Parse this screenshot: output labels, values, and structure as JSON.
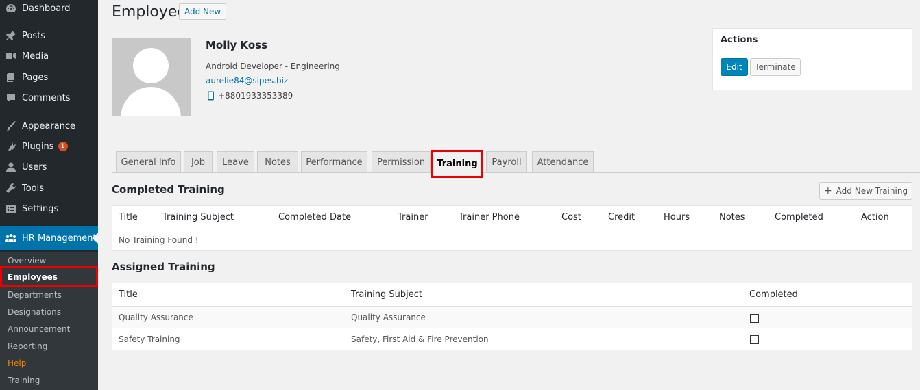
{
  "sidebar": {
    "items": [
      {
        "label": "Dashboard",
        "icon": "dashboard-icon"
      },
      {
        "label": "Posts",
        "icon": "pin-icon"
      },
      {
        "label": "Media",
        "icon": "media-icon"
      },
      {
        "label": "Pages",
        "icon": "pages-icon"
      },
      {
        "label": "Comments",
        "icon": "comment-icon"
      },
      {
        "label": "Appearance",
        "icon": "brush-icon"
      },
      {
        "label": "Plugins",
        "icon": "plugin-icon",
        "badge": "1"
      },
      {
        "label": "Users",
        "icon": "user-icon"
      },
      {
        "label": "Tools",
        "icon": "wrench-icon"
      },
      {
        "label": "Settings",
        "icon": "settings-icon"
      },
      {
        "label": "HR Management",
        "icon": "groups-icon"
      }
    ],
    "submenu": [
      {
        "label": "Overview"
      },
      {
        "label": "Employees"
      },
      {
        "label": "Departments"
      },
      {
        "label": "Designations"
      },
      {
        "label": "Announcement"
      },
      {
        "label": "Reporting"
      },
      {
        "label": "Help"
      },
      {
        "label": "Training"
      }
    ],
    "colors": {
      "bg": "#23282d",
      "submenu_bg": "#32373c",
      "active": "#0073aa",
      "help": "#f18500",
      "badge": "#d54e21"
    }
  },
  "header": {
    "title": "Employee",
    "add_new": "Add New"
  },
  "employee": {
    "name": "Molly Koss",
    "role": "Android Developer - Engineering",
    "email": "aurelie84@sipes.biz",
    "phone": "+8801933353389"
  },
  "actions": {
    "title": "Actions",
    "edit": "Edit",
    "terminate": "Terminate"
  },
  "tabs": [
    {
      "label": "General Info"
    },
    {
      "label": "Job"
    },
    {
      "label": "Leave"
    },
    {
      "label": "Notes"
    },
    {
      "label": "Performance"
    },
    {
      "label": "Permission"
    },
    {
      "label": "Training",
      "active": true
    },
    {
      "label": "Payroll"
    },
    {
      "label": "Attendance"
    }
  ],
  "completed_training": {
    "title": "Completed Training",
    "add_button": "Add New Training",
    "columns": [
      "Title",
      "Training Subject",
      "Completed Date",
      "Trainer",
      "Trainer Phone",
      "Cost",
      "Credit",
      "Hours",
      "Notes",
      "Completed",
      "Action"
    ],
    "empty_message": "No Training Found !"
  },
  "assigned_training": {
    "title": "Assigned Training",
    "columns": [
      "Title",
      "Training Subject",
      "Completed"
    ],
    "rows": [
      {
        "title": "Quality Assurance",
        "subject": "Quality Assurance",
        "completed": false
      },
      {
        "title": "Safety Training",
        "subject": "Safety, First Aid & Fire Prevention",
        "completed": false
      }
    ]
  }
}
